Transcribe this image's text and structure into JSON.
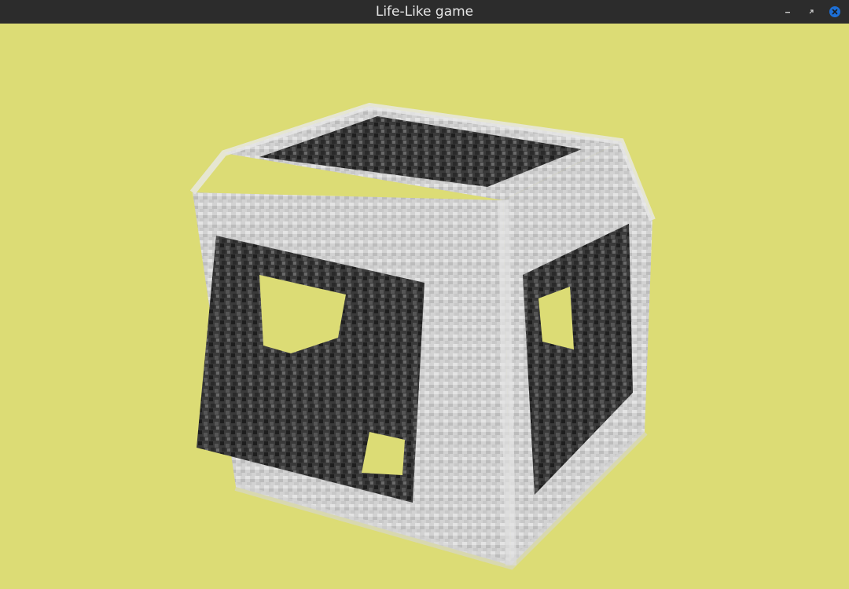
{
  "window": {
    "title": "Life-Like game"
  },
  "colors": {
    "titlebar": "#2c2c2c",
    "title_text": "#e6e6e6",
    "background": "#dcdc75",
    "close_button": "#1d6fd6",
    "cube_light": "#d8d8d8",
    "cube_dark": "#2a2a2a"
  },
  "icons": {
    "minimize": "minimize-icon",
    "restore": "restore-icon",
    "close": "close-icon"
  }
}
